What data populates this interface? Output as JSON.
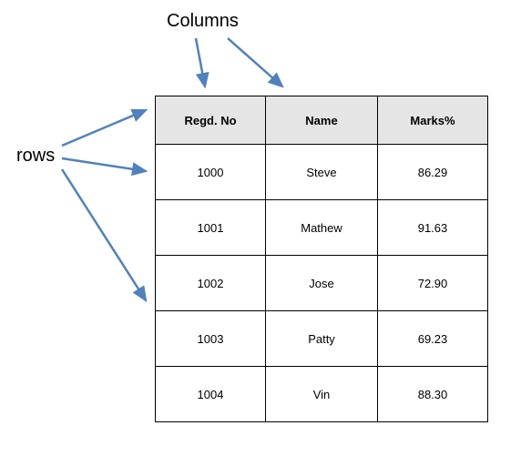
{
  "labels": {
    "columns": "Columns",
    "rows": "rows"
  },
  "table": {
    "headers": [
      "Regd. No",
      "Name",
      "Marks%"
    ],
    "rows": [
      [
        "1000",
        "Steve",
        "86.29"
      ],
      [
        "1001",
        "Mathew",
        "91.63"
      ],
      [
        "1002",
        "Jose",
        "72.90"
      ],
      [
        "1003",
        "Patty",
        "69.23"
      ],
      [
        "1004",
        "Vin",
        "88.30"
      ]
    ]
  },
  "arrow_color": "#4f81bd"
}
